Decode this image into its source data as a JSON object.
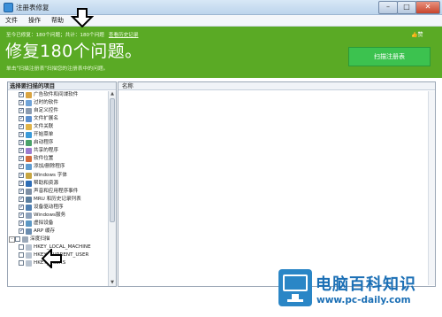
{
  "window": {
    "title": "注册表修复"
  },
  "menu": [
    "文件",
    "操作",
    "帮助"
  ],
  "banner": {
    "stats_prefix": "至今已修复：",
    "fixed_count": "180个问题",
    "total_prefix": "；共计：",
    "total_count": "180个问题",
    "history_link": "查看历史记录",
    "headline": "修复180个问题。",
    "hint": "单击\"扫描注册表\"扫描您的注册表中的问题。",
    "like": "赞",
    "scan_button": "扫描注册表",
    "color": "#5aaa25"
  },
  "left_panel": {
    "header": "选择要扫描的项目",
    "items": [
      {
        "label": "广告软件和间谍软件",
        "checked": true,
        "indent": 1,
        "icon": "adware-icon",
        "color": "#d9a441"
      },
      {
        "label": "过时的软件",
        "checked": true,
        "indent": 1,
        "icon": "software-icon",
        "color": "#6fa3d8"
      },
      {
        "label": "自定义控件",
        "checked": true,
        "indent": 1,
        "icon": "control-icon",
        "color": "#8b9bb0"
      },
      {
        "label": "文件扩展名",
        "checked": true,
        "indent": 1,
        "icon": "file-ext-icon",
        "color": "#5b8fcf"
      },
      {
        "label": "文件关联",
        "checked": true,
        "indent": 1,
        "icon": "file-assoc-icon",
        "color": "#e0b347"
      },
      {
        "label": "开始菜单",
        "checked": true,
        "indent": 1,
        "icon": "start-menu-icon",
        "color": "#3a9ad9"
      },
      {
        "label": "启动程序",
        "checked": true,
        "indent": 1,
        "icon": "startup-icon",
        "color": "#4aa26a"
      },
      {
        "label": "共享的程序",
        "checked": true,
        "indent": 1,
        "icon": "shared-icon",
        "color": "#9c7ccf"
      },
      {
        "label": "软件位置",
        "checked": true,
        "indent": 1,
        "icon": "location-icon",
        "color": "#d36b3b"
      },
      {
        "label": "添加/删除程序",
        "checked": true,
        "indent": 1,
        "icon": "add-remove-icon",
        "color": "#5e9bd0"
      },
      {
        "label": "Windows 字体",
        "checked": true,
        "indent": 1,
        "icon": "fonts-icon",
        "color": "#c7a540"
      },
      {
        "label": "帮助和资源",
        "checked": true,
        "indent": 1,
        "icon": "help-icon",
        "color": "#2e6db6"
      },
      {
        "label": "声音和应用程序事件",
        "checked": true,
        "indent": 1,
        "icon": "sound-icon",
        "color": "#7e8fa5"
      },
      {
        "label": "MRU 和历史记录列表",
        "checked": true,
        "indent": 1,
        "icon": "mru-icon",
        "color": "#5c7e9e"
      },
      {
        "label": "设备驱动程序",
        "checked": true,
        "indent": 1,
        "icon": "driver-icon",
        "color": "#4f7fb2"
      },
      {
        "label": "Windows服务",
        "checked": true,
        "indent": 1,
        "icon": "services-icon",
        "color": "#8ca1bb"
      },
      {
        "label": "虚拟设备",
        "checked": true,
        "indent": 1,
        "icon": "virtual-device-icon",
        "color": "#5d98c4"
      },
      {
        "label": "ARP 缓存",
        "checked": true,
        "indent": 1,
        "icon": "arp-icon",
        "color": "#6b8db0"
      },
      {
        "label": "深度扫描",
        "checked": false,
        "indent": 0,
        "icon": "deep-scan-icon",
        "color": "#9aa8b8"
      },
      {
        "label": "HKEY_LOCAL_MACHINE",
        "checked": false,
        "indent": 2,
        "icon": "registry-icon",
        "color": "#b7c2cf"
      },
      {
        "label": "HKEY_CURRENT_USER",
        "checked": false,
        "indent": 2,
        "icon": "registry-icon",
        "color": "#b7c2cf"
      },
      {
        "label": "HKEY_USERS",
        "checked": false,
        "indent": 2,
        "icon": "registry-icon",
        "color": "#b7c2cf"
      }
    ]
  },
  "right_panel": {
    "column_header": "名称"
  },
  "watermark": {
    "title": "电脑百科知识",
    "url": "www.pc-daily.com"
  }
}
